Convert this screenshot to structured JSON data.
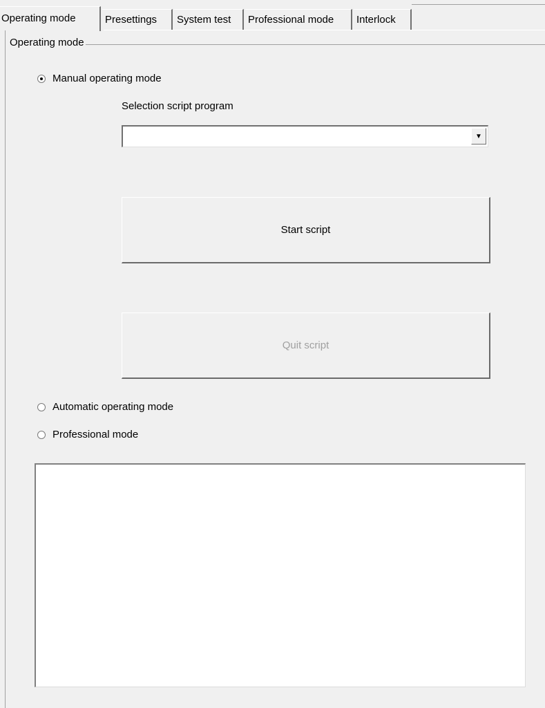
{
  "tabs": [
    {
      "label": "Operating mode",
      "active": true
    },
    {
      "label": "Presettings",
      "active": false
    },
    {
      "label": "System test",
      "active": false
    },
    {
      "label": "Professional mode",
      "active": false
    },
    {
      "label": "Interlock",
      "active": false
    }
  ],
  "group": {
    "title": "Operating mode",
    "manual": {
      "label": "Manual operating mode",
      "selected": true,
      "script_label": "Selection script program",
      "script_value": "",
      "start_label": "Start script",
      "quit_label": "Quit script"
    },
    "automatic": {
      "label": "Automatic operating mode",
      "selected": false
    },
    "professional": {
      "label": "Professional mode",
      "selected": false
    },
    "output_text": ""
  },
  "icons": {
    "dropdown": "chevron-down-icon"
  }
}
